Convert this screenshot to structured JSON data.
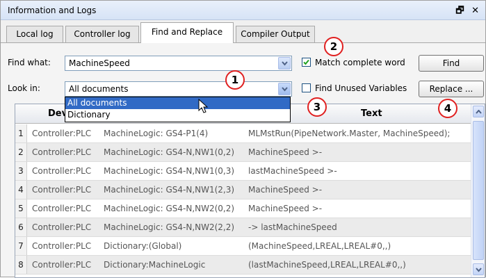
{
  "window": {
    "title": "Information and Logs",
    "controls_label": "🗗 ✕"
  },
  "tabs": [
    {
      "label": "Local log",
      "active": false
    },
    {
      "label": "Controller log",
      "active": false
    },
    {
      "label": "Find and Replace",
      "active": true
    },
    {
      "label": "Compiler Output",
      "active": false
    }
  ],
  "find": {
    "find_label": "Find what:",
    "find_value": "MachineSpeed",
    "look_label": "Look in:",
    "look_value": "All documents",
    "match_label": "Match complete word",
    "match_checked": true,
    "unused_label": "Find Unused Variables",
    "unused_checked": false,
    "find_button": "Find",
    "replace_button": "Replace ..."
  },
  "dropdown_options": [
    {
      "label": "All documents",
      "selected": true
    },
    {
      "label": "Dictionary",
      "selected": false
    }
  ],
  "grid": {
    "columns": [
      "Dev",
      "Text"
    ],
    "rows": [
      {
        "num": "1",
        "device": "Controller:PLC",
        "location": "MachineLogic: GS4-P1(4)",
        "text": "MLMstRun(PipeNetwork.Master, MachineSpeed);"
      },
      {
        "num": "2",
        "device": "Controller:PLC",
        "location": "MachineLogic: GS4-N,NW1(0,2)",
        "text": "MachineSpeed >-"
      },
      {
        "num": "3",
        "device": "Controller:PLC",
        "location": "MachineLogic: GS4-N,NW1(0,3)",
        "text": "lastMachineSpeed >-"
      },
      {
        "num": "4",
        "device": "Controller:PLC",
        "location": "MachineLogic: GS4-N,NW1(2,3)",
        "text": "MachineSpeed >-"
      },
      {
        "num": "5",
        "device": "Controller:PLC",
        "location": "MachineLogic: GS4-N,NW2(0,2)",
        "text": "MachineSpeed >-"
      },
      {
        "num": "6",
        "device": "Controller:PLC",
        "location": "MachineLogic: GS4-N,NW2(2,2)",
        "text": "-> lastMachineSpeed"
      },
      {
        "num": "7",
        "device": "Controller:PLC",
        "location": "Dictionary:(Global)",
        "text": "(MachineSpeed,LREAL,LREAL#0,,)"
      },
      {
        "num": "8",
        "device": "Controller:PLC",
        "location": "Dictionary:MachineLogic",
        "text": "(lastMachineSpeed,LREAL,LREAL#0,,)"
      }
    ]
  },
  "callouts": [
    "1",
    "2",
    "3",
    "4"
  ],
  "colors": {
    "callout_border": "#e02020",
    "selection": "#316ac5",
    "titlebar": "#d6e3f6"
  }
}
